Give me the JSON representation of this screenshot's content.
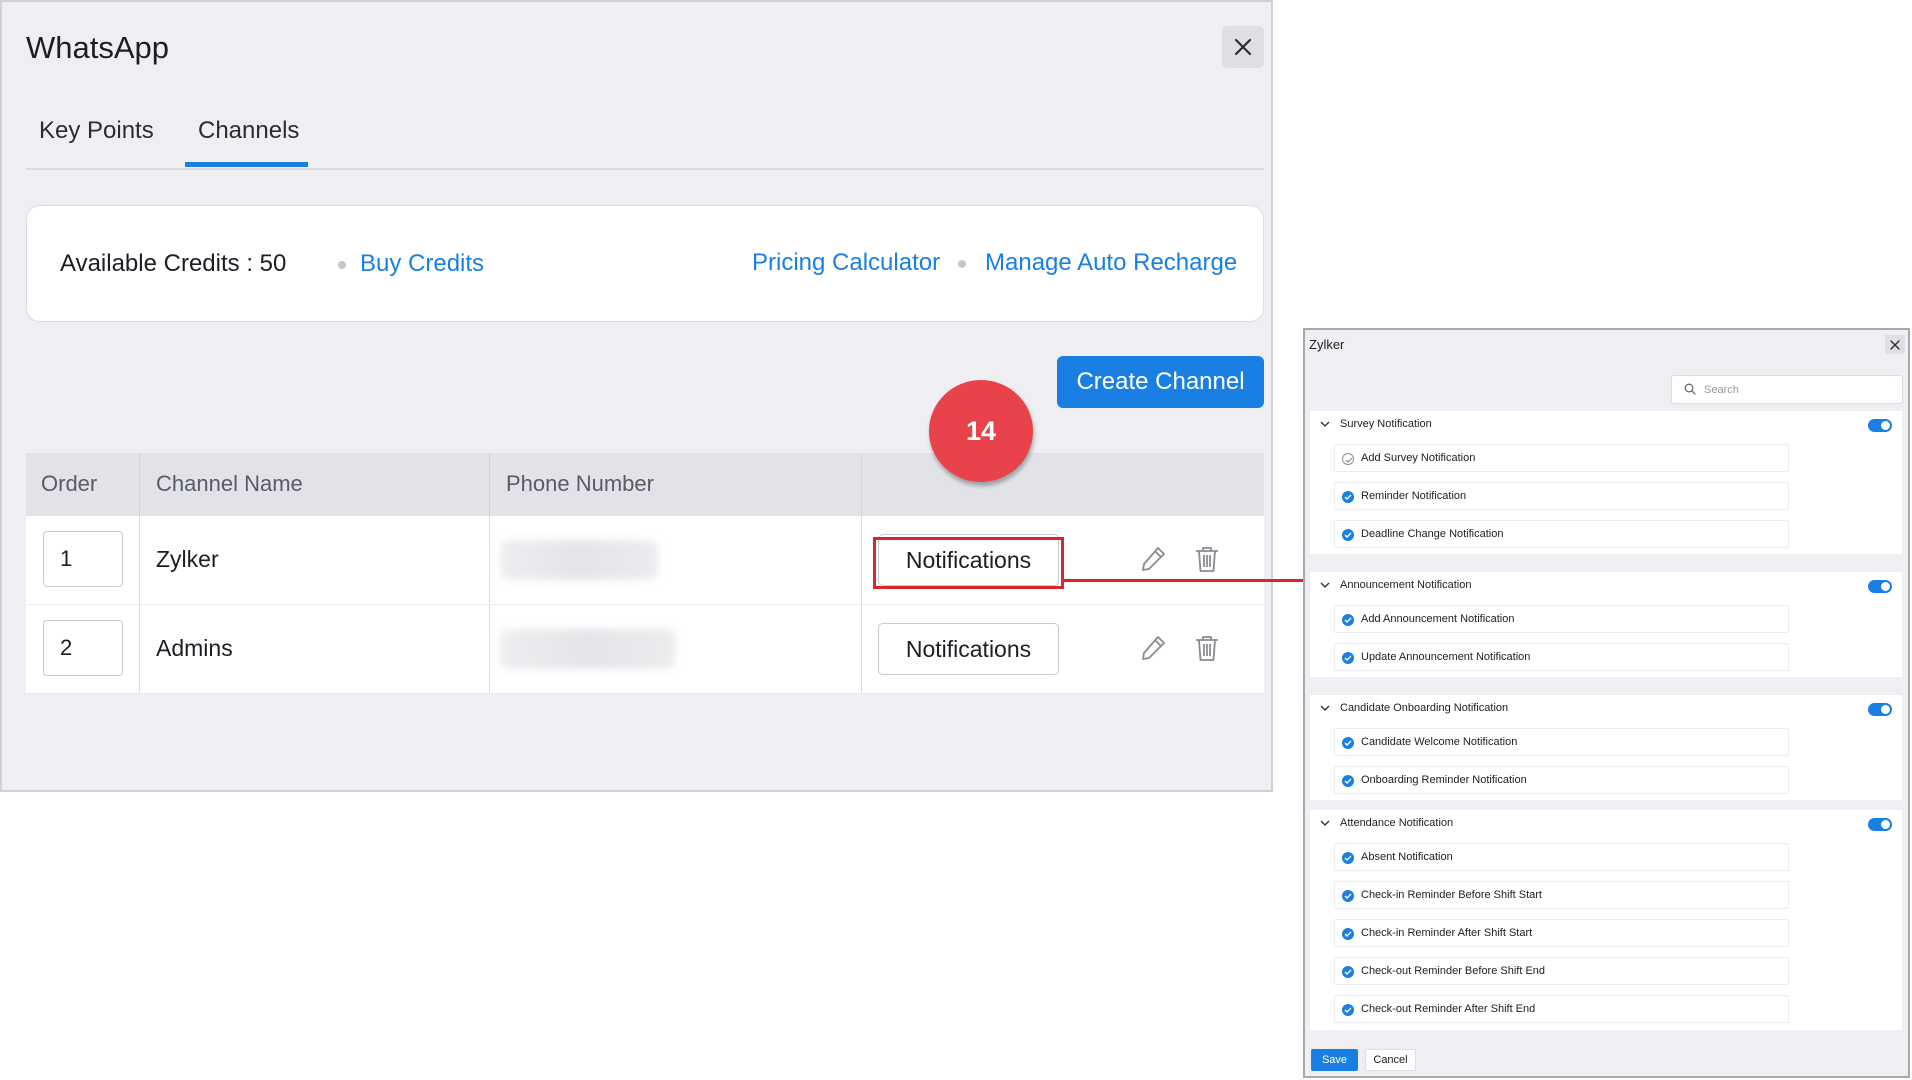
{
  "dialog": {
    "title": "WhatsApp",
    "tabs": [
      {
        "label": "Key Points",
        "active": false
      },
      {
        "label": "Channels",
        "active": true
      }
    ],
    "credits": {
      "label": "Available Credits : 50",
      "buy_link": "Buy Credits",
      "pricing_link": "Pricing Calculator",
      "auto_recharge_link": "Manage Auto Recharge"
    },
    "create_button": "Create Channel",
    "step_badge": "14",
    "table": {
      "headers": [
        "Order",
        "Channel Name",
        "Phone Number"
      ],
      "rows": [
        {
          "order": "1",
          "name": "Zylker",
          "notifications_label": "Notifications"
        },
        {
          "order": "2",
          "name": "Admins",
          "notifications_label": "Notifications"
        }
      ]
    }
  },
  "panel": {
    "title": "Zylker",
    "search_placeholder": "Search",
    "groups": [
      {
        "title": "Survey Notification",
        "enabled": true,
        "items": [
          {
            "label": "Add Survey Notification",
            "checked": false
          },
          {
            "label": "Reminder Notification",
            "checked": true
          },
          {
            "label": "Deadline Change Notification",
            "checked": true
          }
        ]
      },
      {
        "title": "Announcement Notification",
        "enabled": true,
        "items": [
          {
            "label": "Add Announcement Notification",
            "checked": true
          },
          {
            "label": "Update Announcement Notification",
            "checked": true
          }
        ]
      },
      {
        "title": "Candidate Onboarding Notification",
        "enabled": true,
        "items": [
          {
            "label": "Candidate Welcome Notification",
            "checked": true
          },
          {
            "label": "Onboarding Reminder Notification",
            "checked": true
          }
        ]
      },
      {
        "title": "Attendance Notification",
        "enabled": true,
        "items": [
          {
            "label": "Absent Notification",
            "checked": true
          },
          {
            "label": "Check-in Reminder Before Shift Start",
            "checked": true
          },
          {
            "label": "Check-in Reminder After Shift Start",
            "checked": true
          },
          {
            "label": "Check-out Reminder Before Shift End",
            "checked": true
          },
          {
            "label": "Check-out Reminder After Shift End",
            "checked": true
          }
        ]
      }
    ],
    "save_label": "Save",
    "cancel_label": "Cancel"
  },
  "colors": {
    "accent": "#1a7fe2",
    "highlight": "#d9252c",
    "badge": "#e8424b"
  }
}
